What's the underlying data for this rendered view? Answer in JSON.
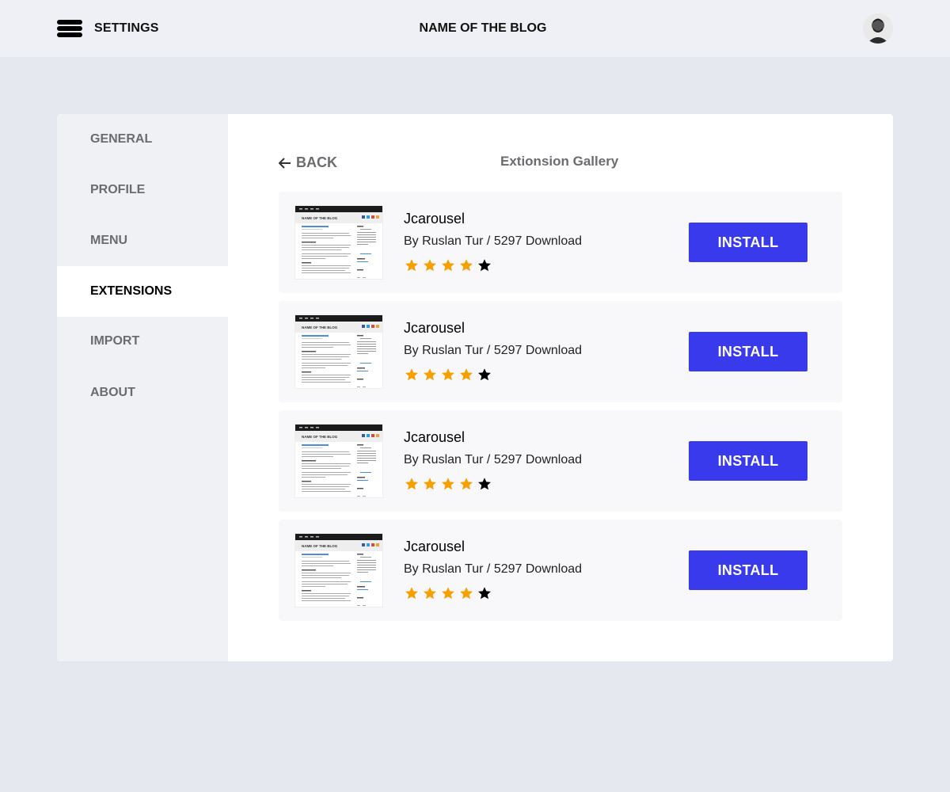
{
  "header": {
    "menu_icon": "hamburger-menu-icon",
    "settings_label": "SETTINGS",
    "blog_title": "NAME OF THE BLOG",
    "avatar_icon": "user-avatar"
  },
  "sidebar": {
    "items": [
      {
        "label": "GENERAL",
        "active": false
      },
      {
        "label": "PROFILE",
        "active": false
      },
      {
        "label": "MENU",
        "active": false
      },
      {
        "label": "EXTENSIONS",
        "active": true
      },
      {
        "label": "IMPORT",
        "active": false
      },
      {
        "label": "ABOUT",
        "active": false
      }
    ]
  },
  "main": {
    "back_label": "BACK",
    "back_icon": "arrow-left-icon",
    "title": "Extionsion Gallery",
    "extensions": [
      {
        "name": "Jcarousel",
        "meta": "By Ruslan Tur / 5297 Download",
        "rating": 4,
        "max_rating": 5,
        "install_label": "INSTALL"
      },
      {
        "name": "Jcarousel",
        "meta": "By Ruslan Tur / 5297 Download",
        "rating": 4,
        "max_rating": 5,
        "install_label": "INSTALL"
      },
      {
        "name": "Jcarousel",
        "meta": "By Ruslan Tur / 5297 Download",
        "rating": 4,
        "max_rating": 5,
        "install_label": "INSTALL"
      },
      {
        "name": "Jcarousel",
        "meta": "By Ruslan Tur / 5297 Download",
        "rating": 4,
        "max_rating": 5,
        "install_label": "INSTALL"
      }
    ]
  },
  "colors": {
    "accent": "#3a3aed",
    "star_filled": "#f5a000",
    "star_empty": "#000000",
    "page_bg": "#e6e8f0"
  }
}
